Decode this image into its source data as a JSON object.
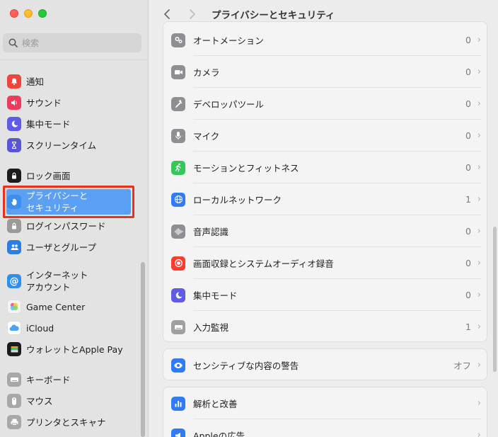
{
  "window": {
    "title": "プライバシーとセキュリティ"
  },
  "search": {
    "placeholder": "検索"
  },
  "sidebar": {
    "items": [
      {
        "label": "通知"
      },
      {
        "label": "サウンド"
      },
      {
        "label": "集中モード"
      },
      {
        "label": "スクリーンタイム"
      },
      {
        "label": "ロック画面"
      },
      {
        "label": "プライバシーと\nセキュリティ"
      },
      {
        "label": "ログインパスワード"
      },
      {
        "label": "ユーザとグループ"
      },
      {
        "label": "インターネット\nアカウント"
      },
      {
        "label": "Game Center"
      },
      {
        "label": "iCloud"
      },
      {
        "label": "ウォレットとApple Pay"
      },
      {
        "label": "キーボード"
      },
      {
        "label": "マウス"
      },
      {
        "label": "プリンタとスキャナ"
      }
    ]
  },
  "main": {
    "rows": [
      {
        "label": "オートメーション",
        "count": "0"
      },
      {
        "label": "カメラ",
        "count": "0"
      },
      {
        "label": "デベロッパツール",
        "count": "0"
      },
      {
        "label": "マイク",
        "count": "0"
      },
      {
        "label": "モーションとフィットネス",
        "count": "0"
      },
      {
        "label": "ローカルネットワーク",
        "count": "1"
      },
      {
        "label": "音声認識",
        "count": "0"
      },
      {
        "label": "画面収録とシステムオーディオ録音",
        "count": "0"
      },
      {
        "label": "集中モード",
        "count": "0"
      },
      {
        "label": "入力監視",
        "count": "1"
      }
    ],
    "sensitive": {
      "label": "センシティブな内容の警告",
      "value": "オフ"
    },
    "analytics": [
      {
        "label": "解析と改善"
      },
      {
        "label": "Appleの広告"
      }
    ]
  },
  "colors": {
    "selection": "#5ba0f2",
    "highlight_border": "#e8321e"
  }
}
